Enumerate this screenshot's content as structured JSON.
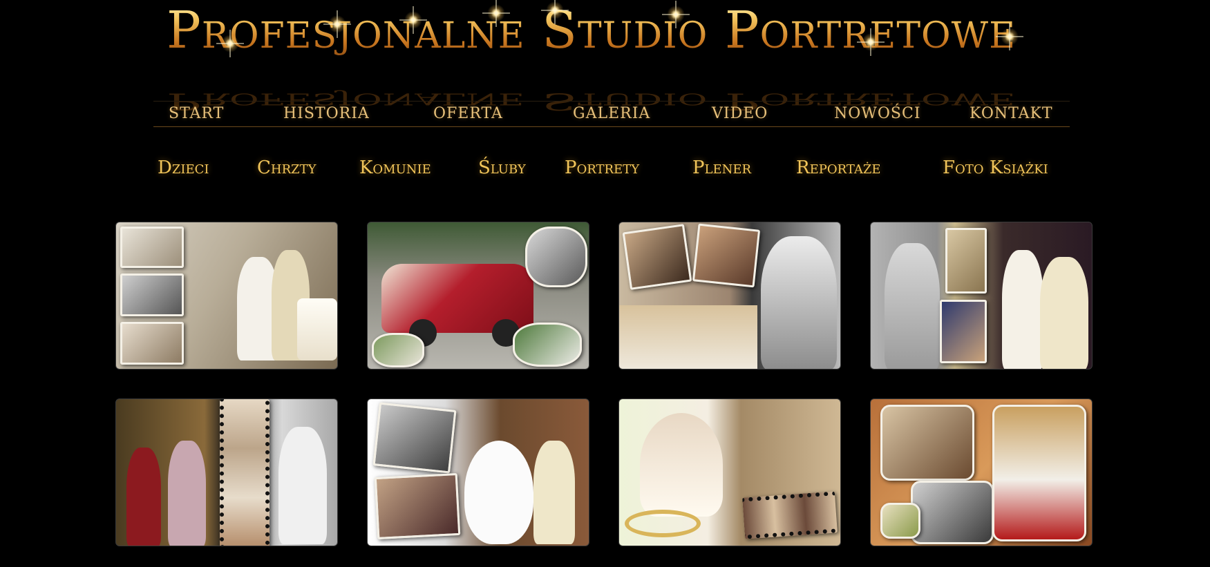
{
  "banner": {
    "title": "Profesjonalne Studio Portretowe"
  },
  "main_nav": [
    {
      "id": "start",
      "label": "START"
    },
    {
      "id": "historia",
      "label": "HISTORIA"
    },
    {
      "id": "oferta",
      "label": "OFERTA"
    },
    {
      "id": "galeria",
      "label": "GALERIA"
    },
    {
      "id": "video",
      "label": "VIDEO"
    },
    {
      "id": "nowosci",
      "label": "NOWOŚCI"
    },
    {
      "id": "kontakt",
      "label": "KONTAKT"
    }
  ],
  "category_nav": [
    {
      "id": "dzieci",
      "label": "Dzieci"
    },
    {
      "id": "chrzty",
      "label": "Chrzty"
    },
    {
      "id": "komunie",
      "label": "Komunie"
    },
    {
      "id": "sluby",
      "label": "Śluby"
    },
    {
      "id": "portrety",
      "label": "Portrety"
    },
    {
      "id": "plener",
      "label": "Plener"
    },
    {
      "id": "reportaze",
      "label": "Reportaże"
    },
    {
      "id": "foto-ksiazki",
      "label": "Foto Książki"
    }
  ],
  "gallery": {
    "thumbnails": [
      {
        "id": "wedding-cake-collage"
      },
      {
        "id": "wedding-car-collage"
      },
      {
        "id": "church-ceremony-collage"
      },
      {
        "id": "bride-toast-collage"
      },
      {
        "id": "reception-filmstrip-collage"
      },
      {
        "id": "reception-guests-collage"
      },
      {
        "id": "rings-embrace-collage"
      },
      {
        "id": "sepia-ceremony-collage"
      }
    ]
  },
  "colors": {
    "background": "#000000",
    "nav_text": "#e7c07a",
    "category_text": "#f1c55a",
    "banner_gold": "#d9a441"
  }
}
